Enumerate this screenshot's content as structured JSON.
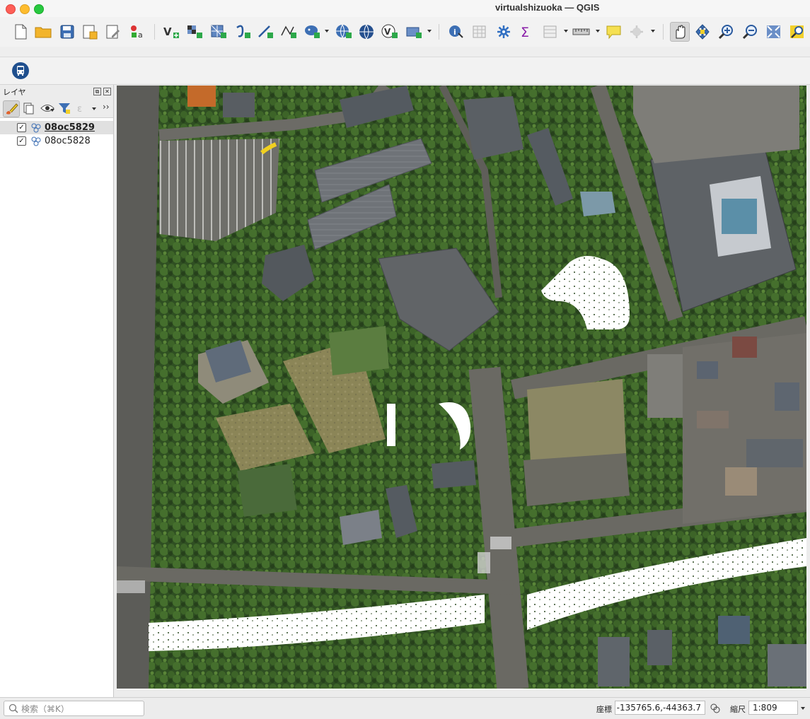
{
  "window": {
    "title": "virtualshizuoka — QGIS"
  },
  "layers_panel": {
    "title": "レイヤ",
    "layers": [
      {
        "name": "08oc5829",
        "checked": true,
        "selected": true
      },
      {
        "name": "08oc5828",
        "checked": true,
        "selected": false
      }
    ]
  },
  "toolbar": {
    "icons": [
      "new-project-icon",
      "open-project-icon",
      "save-project-icon",
      "new-print-layout-icon",
      "layout-manager-icon",
      "style-manager-icon",
      "new-vector-layer-icon",
      "new-raster-layer-icon",
      "new-grid-icon",
      "digitize-curve-icon",
      "new-line-icon",
      "add-vertex-layer-icon",
      "add-postgis-layer-icon",
      "add-wms-layer-icon",
      "add-wfs-layer-icon",
      "add-wcs-layer-icon",
      "add-vector-tile-icon",
      "identify-icon",
      "open-attribute-table-icon",
      "settings-gear-icon",
      "statistics-sigma-icon",
      "attribute-table-icon",
      "measure-icon",
      "annotation-icon",
      "select-icon",
      "pan-hand-icon",
      "pan-to-selection-icon",
      "zoom-in-icon",
      "zoom-out-icon",
      "zoom-full-icon",
      "zoom-to-layer-icon"
    ],
    "plugin_icon": "bus-plugin-icon"
  },
  "statusbar": {
    "search_placeholder": "検索（⌘K）",
    "coord_label": "座標",
    "coordinate": "-135765.6,-44363.7",
    "scale_label": "縮尺",
    "scale": "1:809"
  },
  "colors": {
    "accent": "#2b6cb0",
    "canvas_bg": "#2f4a23"
  }
}
